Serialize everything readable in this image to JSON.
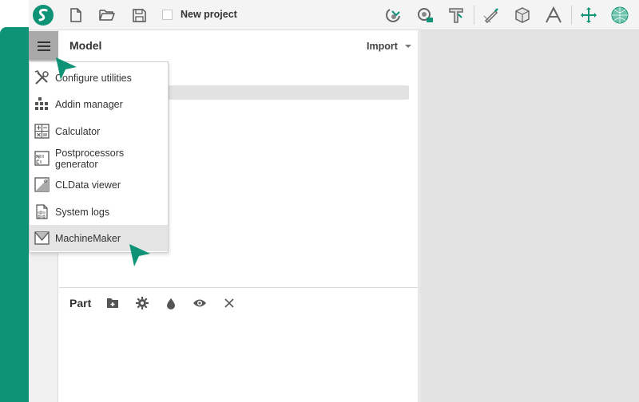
{
  "toolbar": {
    "project_title": "New project",
    "icons": [
      "logo-icon",
      "new-file-icon",
      "open-folder-icon",
      "save-icon",
      "magnet-tool-icon",
      "gear-camera-icon",
      "text-3d-icon",
      "pen-tool-icon",
      "cube-icon",
      "text-a-icon",
      "move-icon",
      "sphere-icon"
    ]
  },
  "model": {
    "title": "Model",
    "import_label": "Import"
  },
  "menu": {
    "items": [
      {
        "label": "Configure utilities",
        "icon": "tools-icon"
      },
      {
        "label": "Addin manager",
        "icon": "addin-grid-icon"
      },
      {
        "label": "Calculator",
        "icon": "calculator-icon"
      },
      {
        "label": "Postprocessors generator",
        "icon": "postprocessor-icon"
      },
      {
        "label": "CLData viewer",
        "icon": "cldata-icon"
      },
      {
        "label": "System logs",
        "icon": "logs-icon"
      },
      {
        "label": "MachineMaker",
        "icon": "machinemaker-icon"
      }
    ],
    "highlighted_index": 6
  },
  "part": {
    "title": "Part",
    "icons": [
      "add-folder-icon",
      "gear-icon",
      "drop-icon",
      "eye-icon",
      "close-icon"
    ]
  },
  "colors": {
    "accent_green": "#0e9376",
    "viewport_bg": "#e3e3e3"
  }
}
